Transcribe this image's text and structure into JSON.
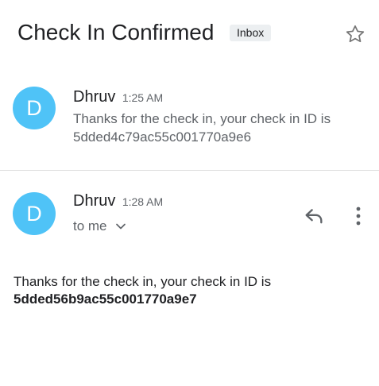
{
  "thread": {
    "subject": "Check In Confirmed",
    "label": "Inbox",
    "star_icon": "star-outline-icon"
  },
  "messages": [
    {
      "avatar_letter": "D",
      "avatar_color": "#4fc3f7",
      "sender": "Dhruv",
      "time": "1:25 AM",
      "snippet": "Thanks for the check in, your check in ID is 5dded4c79ac55c001770a9e6"
    },
    {
      "avatar_letter": "D",
      "avatar_color": "#4fc3f7",
      "sender": "Dhruv",
      "time": "1:28 AM",
      "recipient": "to me",
      "body_text": "Thanks for the check in, your check in ID is",
      "body_id": "5dded56b9ac55c001770a9e7",
      "reply_icon": "reply-icon",
      "more_icon": "more-vert-icon",
      "chevron_icon": "chevron-down-icon"
    }
  ]
}
